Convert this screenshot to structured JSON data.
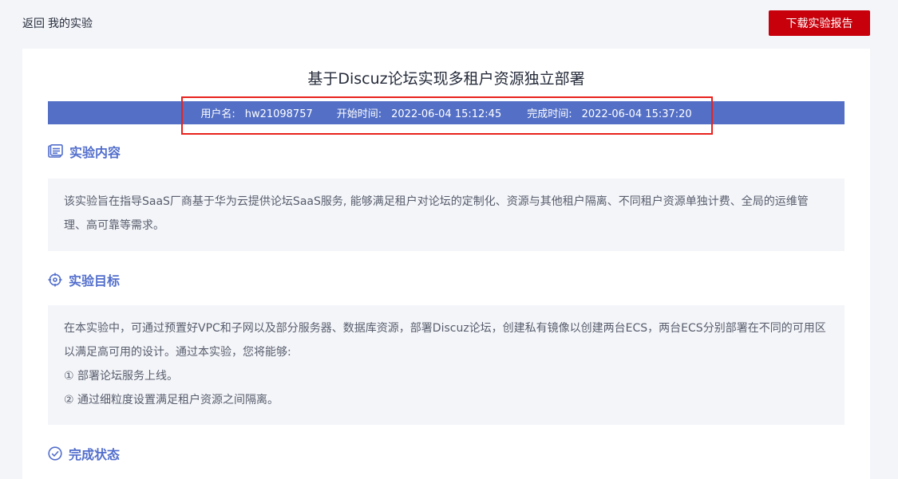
{
  "topbar": {
    "back_label": "返回",
    "my_experiments_label": "我的实验",
    "download_label": "下载实验报告"
  },
  "report": {
    "title": "基于Discuz论坛实现多租户资源独立部署",
    "info": {
      "username_label": "用户名:",
      "username": "hw21098757",
      "start_label": "开始时间:",
      "start_time": "2022-06-04 15:12:45",
      "end_label": "完成时间:",
      "end_time": "2022-06-04 15:37:20"
    }
  },
  "sections": {
    "content": {
      "title": "实验内容",
      "icon": "content-icon",
      "text": "该实验旨在指导SaaS厂商基于华为云提供论坛SaaS服务, 能够满足租户对论坛的定制化、资源与其他租户隔离、不同租户资源单独计费、全局的运维管理、高可靠等需求。"
    },
    "goal": {
      "title": "实验目标",
      "icon": "target-icon",
      "text": "在本实验中，可通过预置好VPC和子网以及部分服务器、数据库资源，部署Discuz论坛，创建私有镜像以创建两台ECS，两台ECS分别部署在不同的可用区以满足高可用的设计。通过本实验，您将能够:",
      "items": [
        "① 部署论坛服务上线。",
        "② 通过细粒度设置满足租户资源之间隔离。"
      ]
    },
    "status": {
      "title": "完成状态",
      "icon": "check-circle-icon"
    }
  },
  "colors": {
    "accent": "#526ecc",
    "band": "#5470c6",
    "download": "#c7000b",
    "highlight": "#e8221d"
  }
}
